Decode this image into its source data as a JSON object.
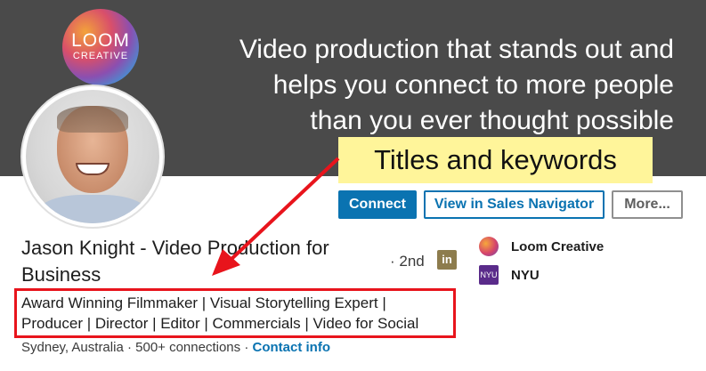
{
  "banner": {
    "logo_line1": "LOOM",
    "logo_line2": "CREATIVE",
    "tagline": [
      "Video production that stands out and",
      "helps you connect to more people",
      "than you ever thought possible"
    ]
  },
  "callout": "Titles and keywords",
  "buttons": {
    "connect": "Connect",
    "sales_navigator": "View in Sales Navigator",
    "more": "More..."
  },
  "profile": {
    "name_line1": "Jason Knight - Video Production for",
    "name_line2": "Business",
    "degree": "· 2nd",
    "headline_line1": "Award Winning Filmmaker | Visual Storytelling Expert |",
    "headline_line2": "Producer | Director | Editor | Commercials | Video for Social",
    "location": "Sydney, Australia",
    "connections": "500+ connections",
    "contact_link": "Contact info"
  },
  "orgs": [
    {
      "label": "Loom Creative",
      "icon": "loom-logo-icon"
    },
    {
      "label": "NYU",
      "icon": "nyu-logo-icon"
    }
  ],
  "colors": {
    "banner": "#4a4a4a",
    "accent": "#0a73b1",
    "callout_bg": "#fff59a",
    "annotation": "#e8141c"
  }
}
